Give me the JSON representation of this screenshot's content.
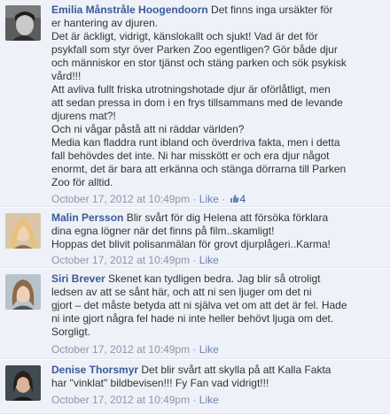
{
  "comments": [
    {
      "author": "Emilia Månstråle Hoogendoorn",
      "lines": [
        " Det finns inga ursäkter för",
        "er hantering av djuren.",
        "Det är äckligt, vidrigt, känslokallt och sjukt! Vad är det för",
        "psykfall som styr över Parken Zoo egentligen? Gör både djur",
        "och människor en stor tjänst och stäng parken och sök psykisk",
        "vård!!!",
        "Att avliva fullt friska utrotningshotade djur är oförlåtligt, men",
        "att sedan pressa in dom i en frys tillsammans med de levande",
        "djurens mat?!",
        "Och ni vågar påstå att ni räddar världen?",
        "Media kan fladdra runt ibland och överdriva fakta, men i detta",
        "fall behövdes det inte. Ni har misskött er och era djur något",
        "enormt, det är bara att erkänna och stänga dörrarna till Parken",
        "Zoo för alltid."
      ],
      "timestamp": "October 17, 2012 at 10:49pm",
      "separator": " · ",
      "like_label": "Like",
      "like_count": "4",
      "like_icon": "thumbs-up-icon"
    },
    {
      "author": "Malin Persson",
      "lines": [
        " Blir svårt för dig Helena att försöka förklara",
        "dina egna lögner när det finns på film..skamligt!",
        "Hoppas det blivit polisanmälan för grovt djurplågeri..Karma!"
      ],
      "timestamp": "October 17, 2012 at 10:49pm",
      "separator": " · ",
      "like_label": "Like"
    },
    {
      "author": "Siri Brever",
      "lines": [
        " Skenet kan tydligen bedra. Jag blir så otroligt",
        "ledsen av att se sånt här, och att ni sen ljuger om det ni",
        "gjort – det måste betyda att ni själva vet om att det är fel. Hade",
        "ni inte gjort några fel hade ni inte heller behövt ljuga om det.",
        "Sorgligt."
      ],
      "timestamp": "October 17, 2012 at 10:49pm",
      "separator": " · ",
      "like_label": "Like"
    },
    {
      "author": "Denise Thorsmyr",
      "lines": [
        " Det blir svårt att skylla på att Kalla Fakta",
        "har \"vinklat\" bildbevisen!!! Fy Fan vad vidrigt!!!"
      ],
      "timestamp": "October 17, 2012 at 10:49pm",
      "separator": " · ",
      "like_label": "Like"
    }
  ]
}
